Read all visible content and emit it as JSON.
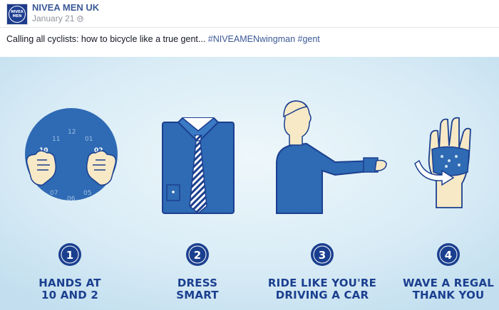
{
  "post": {
    "page_name": "NIVEA MEN UK",
    "date": "January 21",
    "avatar_text": [
      "NIVEA",
      "MEN"
    ],
    "caption_text": "Calling all cyclists: how to bicycle like a true gent... ",
    "caption_tags": "#NIVEAMENwingman #gent"
  },
  "infographic": {
    "clock_numbers": [
      "12",
      "01",
      "02",
      "11",
      "10",
      "07",
      "06",
      "05"
    ],
    "steps": [
      {
        "number": "1",
        "line1": "HANDS AT",
        "line2": "10 AND 2"
      },
      {
        "number": "2",
        "line1": "DRESS",
        "line2": "SMART"
      },
      {
        "number": "3",
        "line1": "RIDE LIKE YOU'RE",
        "line2": "DRIVING A CAR"
      },
      {
        "number": "4",
        "line1": "WAVE A REGAL",
        "line2": "THANK YOU"
      }
    ]
  },
  "colors": {
    "brand_blue": "#1b3f8f",
    "link_blue": "#3b5998",
    "background_blue": "#d8ebf5",
    "skin": "#f7e9c6"
  },
  "icons": {
    "audience": "globe-icon"
  }
}
